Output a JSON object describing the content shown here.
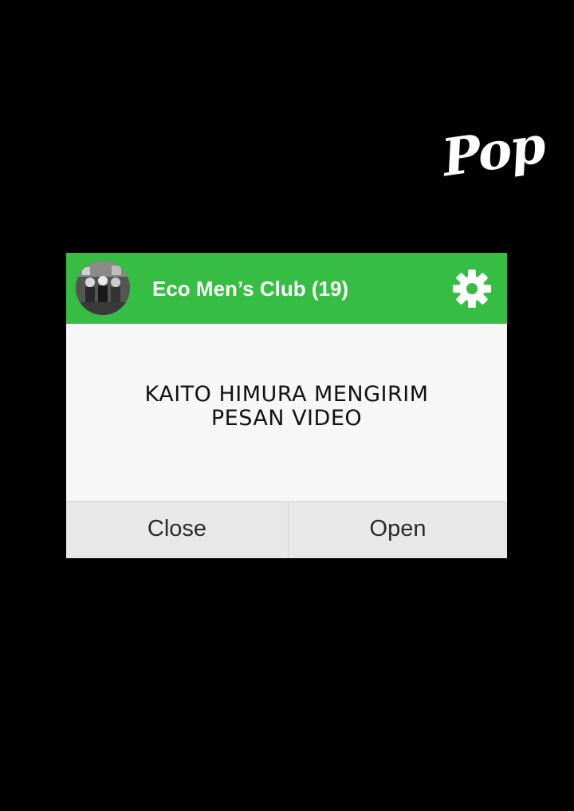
{
  "overlay": {
    "sound_effect": "Pop"
  },
  "dialog": {
    "header": {
      "group_name": "Eco Men’s Club (19)",
      "settings_icon": "gear-icon",
      "header_color": "#36bd44"
    },
    "message": {
      "line1": "KAITO HIMURA MENGIRIM",
      "line2": "PESAN VIDEO"
    },
    "buttons": {
      "close_label": "Close",
      "open_label": "Open"
    }
  }
}
